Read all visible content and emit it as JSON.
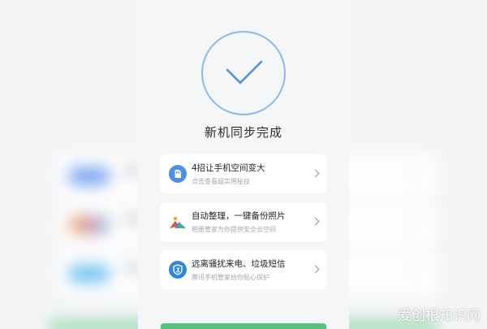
{
  "status": {
    "title": "新机同步完成"
  },
  "cards": [
    {
      "main": "4招让手机空间变大",
      "sub": "点击查看超实用秘技",
      "icon": "sd-card-icon"
    },
    {
      "main": "自动整理，一键备份照片",
      "sub": "相册管家为你提供安全云空间",
      "icon": "photo-gallery-icon"
    },
    {
      "main": "远离骚扰来电、垃圾短信",
      "sub": "腾讯手机管家给你贴心保护",
      "icon": "shield-icon"
    }
  ],
  "watermark": "爱创根知识网",
  "colors": {
    "accent_blue": "#4f8fe6",
    "action_green": "#57c27c"
  }
}
